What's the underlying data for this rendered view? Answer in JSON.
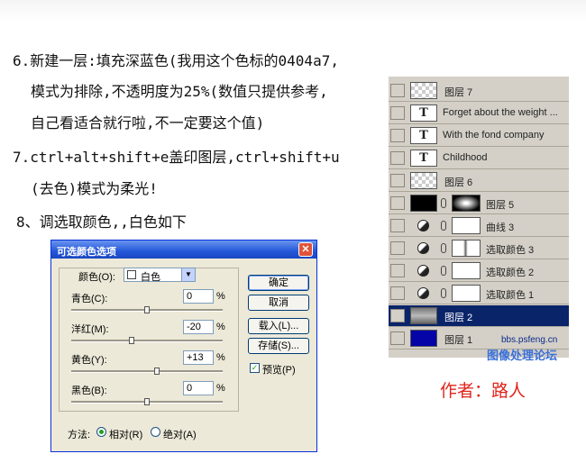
{
  "instructions": [
    "6.新建一层:填充深蓝色(我用这个色标的0404a7,",
    "模式为排除,不透明度为25%(数值只提供参考,",
    "自己看适合就行啦,不一定要这个值)",
    "7.ctrl+alt+shift+e盖印图层,ctrl+shift+u",
    "(去色)模式为柔光!",
    "8、调选取颜色,,白色如下"
  ],
  "layers": [
    {
      "name": "图层 7",
      "kind": "pixel",
      "thumb": "transparent"
    },
    {
      "name": "Forget about the weight ...",
      "kind": "text",
      "glyph": "T"
    },
    {
      "name": "With the fond company",
      "kind": "text",
      "glyph": "T"
    },
    {
      "name": "Childhood",
      "kind": "text",
      "glyph": "T"
    },
    {
      "name": "图层 6",
      "kind": "pixel",
      "thumb": "transparent"
    },
    {
      "name": "图层 5",
      "kind": "masked",
      "thumb": "black"
    },
    {
      "name": "曲线 3",
      "kind": "adjustment"
    },
    {
      "name": "选取颜色 3",
      "kind": "adjustment"
    },
    {
      "name": "选取颜色 2",
      "kind": "adjustment"
    },
    {
      "name": "选取颜色 1",
      "kind": "adjustment"
    },
    {
      "name": "图层 2",
      "kind": "pixel",
      "thumb": "photo",
      "selected": true
    },
    {
      "name": "图层 1",
      "kind": "pixel",
      "thumb": "blue"
    }
  ],
  "dialog": {
    "title": "可选颜色选项",
    "close_glyph": "✕",
    "color_label": "颜色(O):",
    "color_value": "白色",
    "sliders": [
      {
        "label": "青色(C):",
        "value": "0",
        "unit": "%",
        "level": 0.5
      },
      {
        "label": "洋红(M):",
        "value": "-20",
        "unit": "%",
        "level": 0.4
      },
      {
        "label": "黄色(Y):",
        "value": "+13",
        "unit": "%",
        "level": 0.565
      },
      {
        "label": "黑色(B):",
        "value": "0",
        "unit": "%",
        "level": 0.5
      }
    ],
    "buttons": {
      "ok": "确定",
      "cancel": "取消",
      "load": "载入(L)...",
      "save": "存储(S)..."
    },
    "preview_label": "预览(P)",
    "preview_checked": true,
    "method_label": "方法:",
    "relative_label": "相对(R)",
    "absolute_label": "绝对(A)",
    "method_selected": "relative"
  },
  "watermark": {
    "url": "bbs.psfeng.cn",
    "forum": "图像处理论坛"
  },
  "author": "作者：路人",
  "colors": {
    "selected_row": "#0a246a",
    "author": "#e0241b",
    "fill_layer": "#0404a7"
  }
}
